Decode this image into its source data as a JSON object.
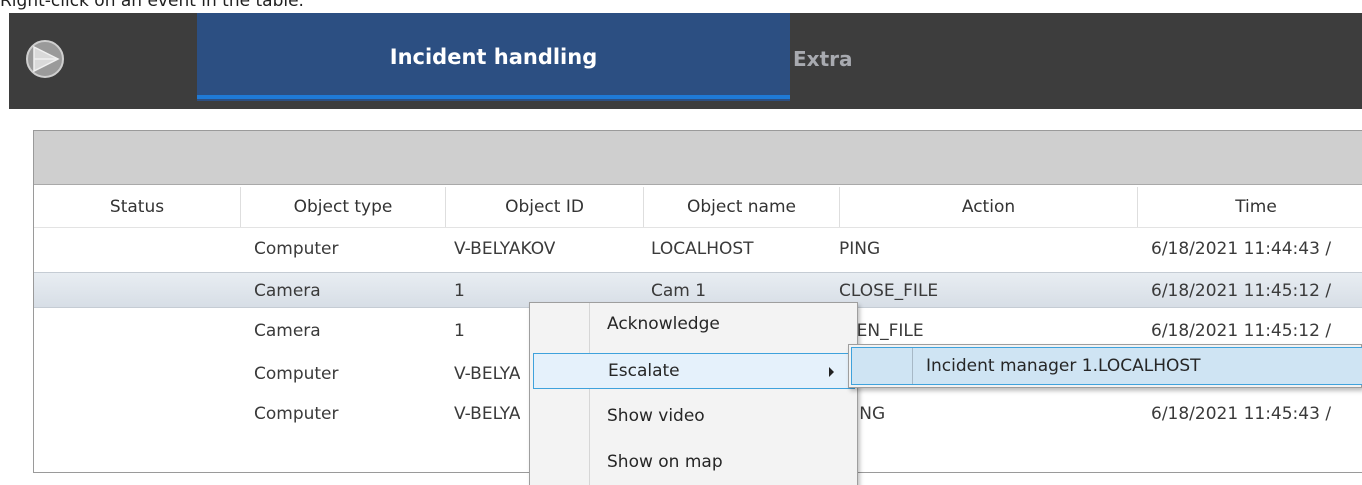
{
  "caption": "Right-click on an event in the table.",
  "tabs": {
    "active": "Incident handling",
    "extra": "Extra"
  },
  "table": {
    "columns": [
      "Status",
      "Object type",
      "Object ID",
      "Object name",
      "Action",
      "Time"
    ],
    "rows": [
      {
        "status": "",
        "object_type": "Computer",
        "object_id": "V-BELYAKOV",
        "object_name": "LOCALHOST",
        "action": "PING",
        "time": "6/18/2021 11:44:43 /"
      },
      {
        "status": "",
        "object_type": "Camera",
        "object_id": "1",
        "object_name": "Cam 1",
        "action": "CLOSE_FILE",
        "time": "6/18/2021 11:45:12 /"
      },
      {
        "status": "",
        "object_type": "Camera",
        "object_id": "1",
        "object_name": "",
        "action": "OPEN_FILE",
        "time": "6/18/2021 11:45:12 /"
      },
      {
        "status": "",
        "object_type": "Computer",
        "object_id": "V-BELYA",
        "object_name": "",
        "action": "",
        "time": ""
      },
      {
        "status": "",
        "object_type": "Computer",
        "object_id": "V-BELYA",
        "object_name": "",
        "action": "PING",
        "time": "6/18/2021 11:45:43 /"
      }
    ]
  },
  "context_menu": {
    "items": [
      "Acknowledge",
      "Escalate",
      "Show video",
      "Show on map"
    ]
  },
  "submenu": {
    "items": [
      "Incident manager 1.LOCALHOST"
    ]
  },
  "colors": {
    "topbar": "#3d3d3d",
    "active_tab": "#2c4f82",
    "tab_underline": "#1f7ad6",
    "menu_highlight": "#3fa2dc"
  }
}
